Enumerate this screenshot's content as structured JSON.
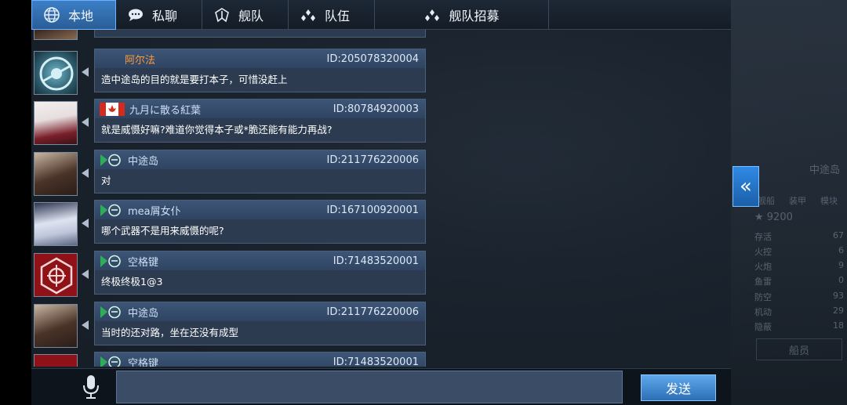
{
  "tabs": [
    {
      "label": "本地",
      "icon": "globe-icon",
      "active": true
    },
    {
      "label": "私聊",
      "icon": "chat-bubble-icon",
      "active": false
    },
    {
      "label": "舰队",
      "icon": "fleet-flag-icon",
      "active": false
    },
    {
      "label": "队伍",
      "icon": "team-icon",
      "active": false
    },
    {
      "label": "舰队招募",
      "icon": "team-icon",
      "active": false
    }
  ],
  "messages": [
    {
      "name": "阿尔法",
      "name_color": "#ff9a3c",
      "id": "ID:205078320004",
      "text": "造中途岛的目的就是要打本子，可惜没赶上",
      "badge": "none"
    },
    {
      "name": "九月に散る紅葉",
      "id": "ID:80784920003",
      "text": "就是威慑好嘛?难道你觉得本子或*脆还能有能力再战?",
      "badge": "canada-flag"
    },
    {
      "name": "中途岛",
      "id": "ID:211776220006",
      "text": "对",
      "badge": "fleet-emblem"
    },
    {
      "name": "mea屑女仆",
      "id": "ID:167100920001",
      "text": "哪个武器不是用来威慑的呢?",
      "badge": "fleet-emblem"
    },
    {
      "name": "空格键",
      "id": "ID:71483520001",
      "text": "终极终极1@3",
      "badge": "fleet-emblem"
    },
    {
      "name": "中途岛",
      "id": "ID:211776220006",
      "text": "当时的还对路，坐在还没有成型",
      "badge": "fleet-emblem"
    },
    {
      "name": "空格键",
      "id": "ID:71483520001",
      "text": "",
      "badge": "fleet-emblem"
    }
  ],
  "input": {
    "value": "",
    "placeholder": ""
  },
  "send_label": "发送",
  "background_panel": {
    "score": "★ 9200",
    "stats": [
      {
        "label": "存活",
        "value": "67"
      },
      {
        "label": "火控",
        "value": "6"
      },
      {
        "label": "火炮",
        "value": "9"
      },
      {
        "label": "鱼雷",
        "value": "0"
      },
      {
        "label": "防空",
        "value": "93"
      },
      {
        "label": "机动",
        "value": "29"
      },
      {
        "label": "隐蔽",
        "value": "18"
      }
    ],
    "crew_button": "船员",
    "ship_label": "中途岛",
    "tabs": [
      "舰船",
      "装甲",
      "模块"
    ]
  },
  "colors": {
    "accent": "#2f8ae6",
    "bubble": "#2c3b4f",
    "orange_name": "#ff9a3c"
  }
}
